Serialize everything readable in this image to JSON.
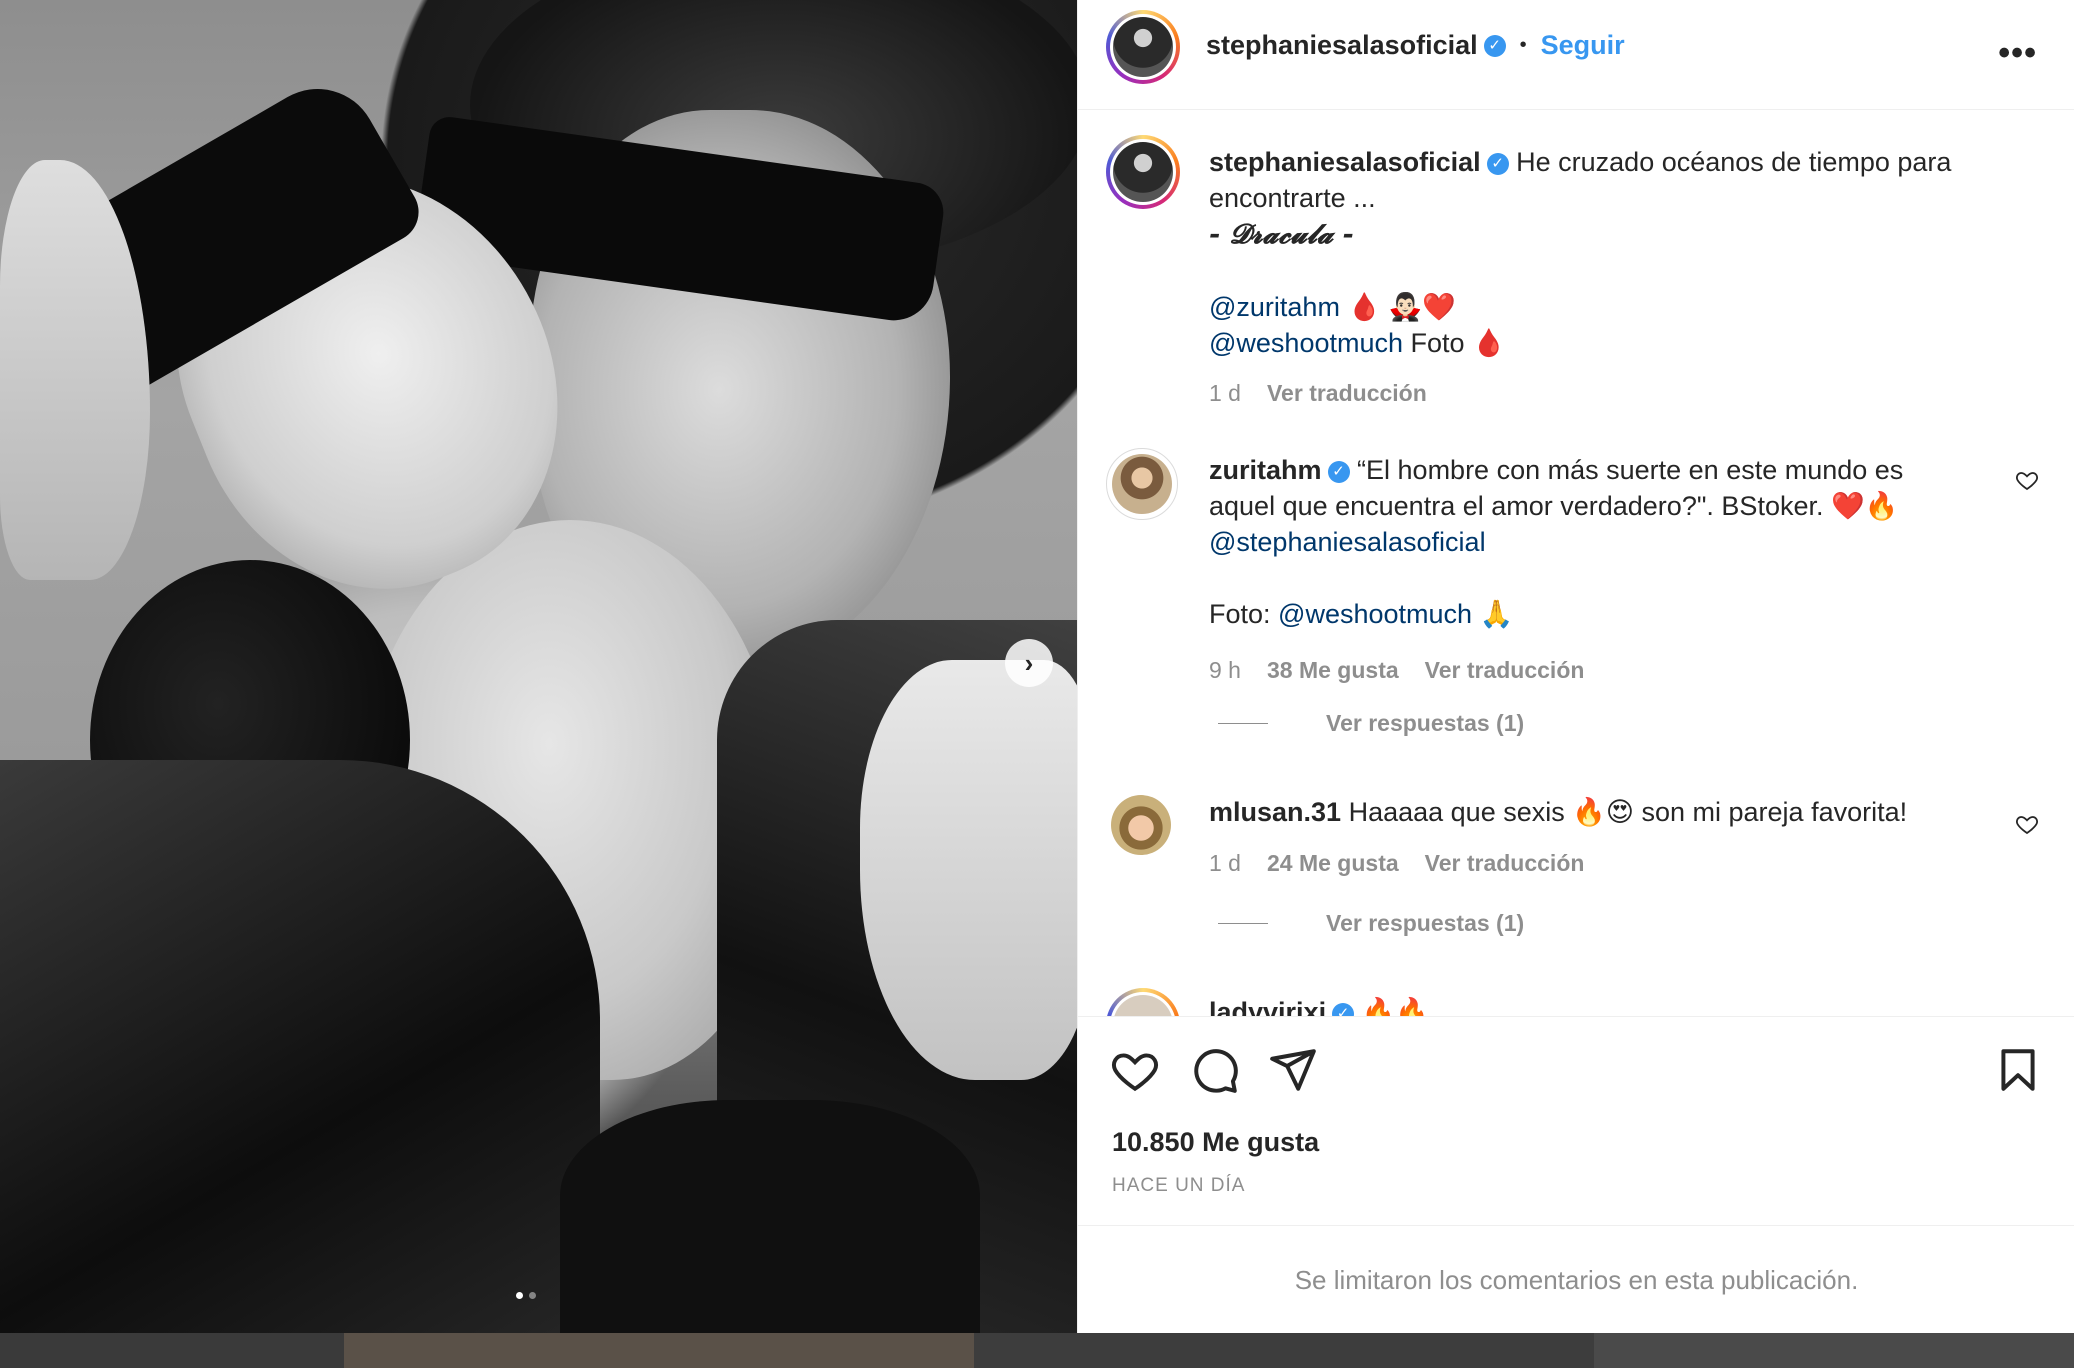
{
  "post": {
    "username": "stephaniesalasoficial",
    "follow_label": "Seguir",
    "separator": "•",
    "more_label": "•••"
  },
  "caption": {
    "username": "stephaniesalasoficial",
    "line1": "He cruzado océanos de tiempo para",
    "line2": "encontrarte ...",
    "line3": "- 𝓓𝓻𝓪𝓬𝓾𝓵𝓪 -",
    "mention1": "@zuritahm",
    "mention1_emoji": "🩸 🧛🏻‍♂️❤️",
    "mention2": "@weshootmuch",
    "mention2_text": " Foto ",
    "mention2_emoji": "🩸",
    "time": "1 d",
    "translate": "Ver traducción"
  },
  "comments": [
    {
      "username": "zuritahm",
      "text_l1": "“El hombre con más suerte en este mundo es",
      "text_l2": "aquel que encuentra el amor verdadero?\". BStoker. ❤️🔥",
      "mention": "@stephaniesalasoficial",
      "foto_label": "Foto: ",
      "foto_mention": "@weshootmuch",
      "foto_emoji": " 🙏",
      "time": "9 h",
      "likes": "38 Me gusta",
      "translate": "Ver traducción",
      "replies": "Ver respuestas (1)"
    },
    {
      "username": "mlusan.31",
      "text": "Haaaaa que sexis 🔥😍 son mi pareja favorita!",
      "time": "1 d",
      "likes": "24 Me gusta",
      "translate": "Ver traducción",
      "replies": "Ver respuestas (1)"
    },
    {
      "username": "ladyvirixi",
      "text": "🔥🔥"
    }
  ],
  "footer": {
    "likes": "10.850 Me gusta",
    "time_ago": "HACE UN DÍA",
    "limited": "Se limitaron los comentarios en esta publicación."
  },
  "icons": {
    "next": "›",
    "like": "heart-icon",
    "comment": "comment-icon",
    "share": "share-icon",
    "save": "bookmark-icon"
  },
  "colors": {
    "link_blue": "#3897f0",
    "mention": "#00376b",
    "muted": "#8e8e8e"
  }
}
